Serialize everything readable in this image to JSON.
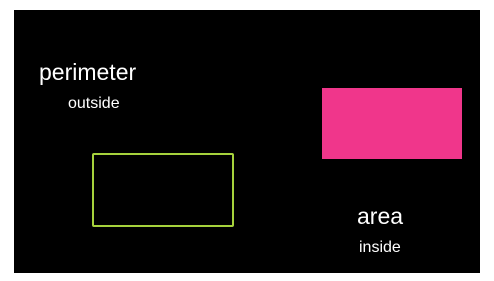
{
  "perimeter": {
    "title": "perimeter",
    "subtitle": "outside",
    "shape_color": "#a6d23c"
  },
  "area": {
    "title": "area",
    "subtitle": "inside",
    "shape_color": "#f0368b"
  },
  "background_color": "#000000"
}
